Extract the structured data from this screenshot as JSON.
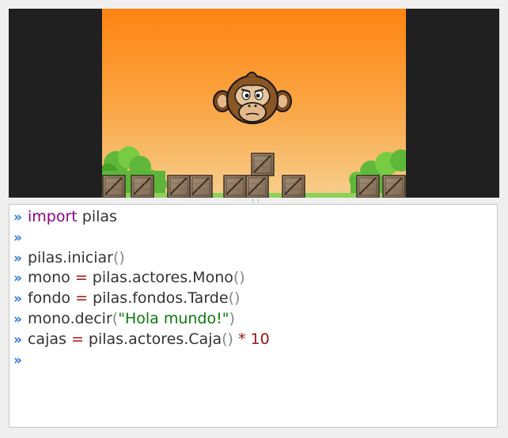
{
  "console": {
    "prompt": "»",
    "lines": [
      [
        {
          "t": "kw",
          "v": "import"
        },
        {
          "t": "txt",
          "v": " pilas"
        }
      ],
      [],
      [
        {
          "t": "txt",
          "v": "pilas.iniciar"
        },
        {
          "t": "paren",
          "v": "()"
        }
      ],
      [
        {
          "t": "txt",
          "v": "mono "
        },
        {
          "t": "op",
          "v": "="
        },
        {
          "t": "txt",
          "v": " pilas.actores.Mono"
        },
        {
          "t": "paren",
          "v": "()"
        }
      ],
      [
        {
          "t": "txt",
          "v": "fondo "
        },
        {
          "t": "op",
          "v": "="
        },
        {
          "t": "txt",
          "v": " pilas.fondos.Tarde"
        },
        {
          "t": "paren",
          "v": "()"
        }
      ],
      [
        {
          "t": "txt",
          "v": "mono.decir"
        },
        {
          "t": "paren",
          "v": "("
        },
        {
          "t": "str",
          "v": "\"Hola mundo!\""
        },
        {
          "t": "paren",
          "v": ")"
        }
      ],
      [
        {
          "t": "txt",
          "v": "cajas "
        },
        {
          "t": "op",
          "v": "="
        },
        {
          "t": "txt",
          "v": " pilas.actores.Caja"
        },
        {
          "t": "paren",
          "v": "()"
        },
        {
          "t": "op",
          "v": " * "
        },
        {
          "t": "num",
          "v": "10"
        }
      ],
      []
    ]
  },
  "stage": {
    "sky_top": "#ff8412",
    "sky_bottom": "#f8c880",
    "actors": [
      "monkey",
      "box",
      "bush"
    ]
  }
}
